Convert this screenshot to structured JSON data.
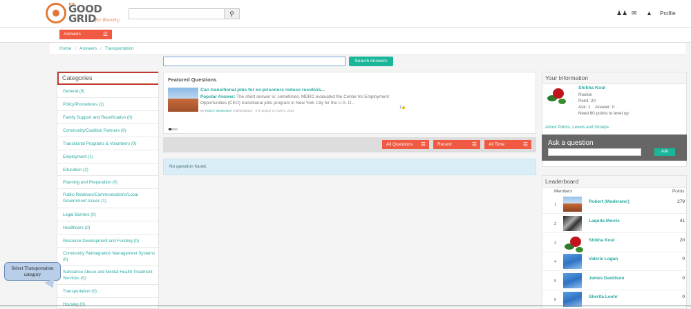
{
  "logo": {
    "the": "THE",
    "word_line1": "GOOD",
    "word_line2": "GRID",
    "tagline": "for Reentry"
  },
  "header": {
    "search_button_icon": "search-icon",
    "profile_label": "Profile",
    "icons": [
      "users-icon",
      "mail-icon",
      "bell-icon"
    ]
  },
  "answers_button": {
    "label": "Answers",
    "icon": "hamburger-icon"
  },
  "breadcrumb": {
    "items": [
      "Home",
      "Answers",
      "Transportation"
    ]
  },
  "search": {
    "placeholder": "",
    "button_label": "Search Answers"
  },
  "categories": {
    "title": "Categories",
    "items": [
      "General (6)",
      "Policy/Procedures (1)",
      "Family Support and Reunification (0)",
      "Community/Coalition Partners (0)",
      "Transitional Programs & Volunteers (0)",
      "Employment (1)",
      "Education (2)",
      "Planning and Preparation (0)",
      "Public Relations/Communications/Local Government Issues (1)",
      "Legal Barriers (0)",
      "Healthcare (0)",
      "Resource Development and Funding (0)",
      "Community Reintegration Management Systems (0)",
      "Substance Abuse and Mental Health Treatment Services (0)",
      "Transportation (0)",
      "Housing (0)"
    ]
  },
  "featured": {
    "title": "Featured Questions",
    "question_title": "Can transitional jobs for ex-prisoners reduce recidivis...",
    "popular_label": "Popular Answer:",
    "answer_text": "The short answer is: sometimes. MDRC evaluated the Center for Employment Opportunities (CEO) transitional jobs program in New York City for the U.S. D...",
    "meta_by": "By",
    "meta_author": "Robert (Moderator)",
    "meta_role": "(Administrator - 279 points)",
    "meta_date": "on April 3, 2014",
    "likes": "1"
  },
  "filters": [
    {
      "label": "All Questions"
    },
    {
      "label": "Recent"
    },
    {
      "label": "All Time"
    }
  ],
  "no_question": "No question found.",
  "your_info": {
    "title": "Your Information",
    "name": "Shikha Koul",
    "rank": "Rookie",
    "points": "Point: 20",
    "ask_answer": "Ask: 1    Answer: 0",
    "level_up": "Need 80 points to level up",
    "link": "About Points, Levels and Groups"
  },
  "ask": {
    "title": "Ask a question",
    "button_label": "Ask"
  },
  "leaderboard": {
    "title": "Leaderboard",
    "col_members": "Members",
    "col_points": "Points",
    "rows": [
      {
        "rank": "1",
        "name": "Robert (Moderator)",
        "points": "279"
      },
      {
        "rank": "2",
        "name": "Laquita Morris",
        "points": "41"
      },
      {
        "rank": "3",
        "name": "Shikha Koul",
        "points": "20"
      },
      {
        "rank": "4",
        "name": "Valerie Logan",
        "points": "0"
      },
      {
        "rank": "5",
        "name": "James Davidson",
        "points": "0"
      },
      {
        "rank": "6",
        "name": "Sherita Loehr",
        "points": "0"
      }
    ]
  },
  "callout": {
    "line1": "Select Transportation",
    "line2": "category"
  }
}
